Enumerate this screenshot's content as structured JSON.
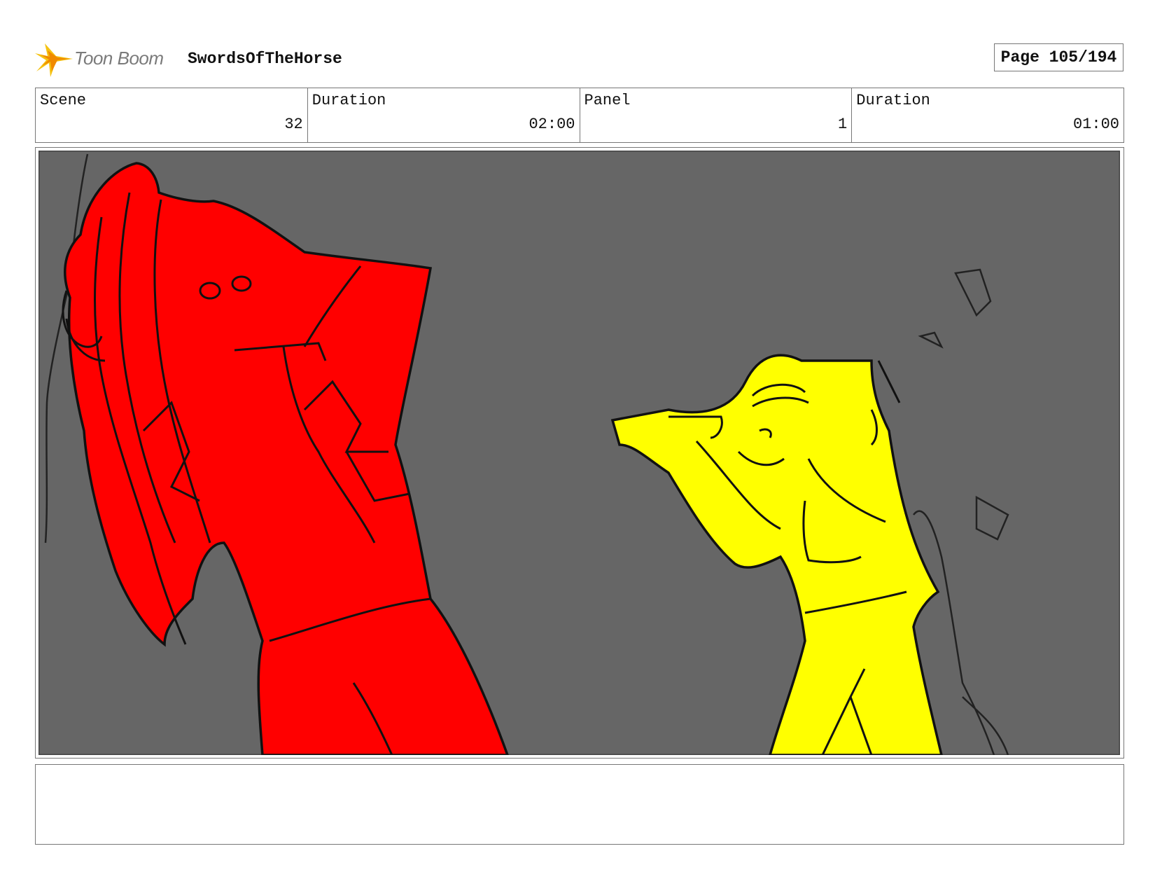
{
  "header": {
    "logo_text": "Toon Boom",
    "project_title": "SwordsOfTheHorse",
    "page_label": "Page 105/194"
  },
  "info": [
    {
      "label": "Scene",
      "value": "32"
    },
    {
      "label": "Duration",
      "value": "02:00"
    },
    {
      "label": "Panel",
      "value": "1"
    },
    {
      "label": "Duration",
      "value": "01:00"
    }
  ],
  "panel": {
    "background_color": "#666666",
    "foreground_character_color": "#ff0000",
    "background_character_color": "#ffff00"
  },
  "caption": ""
}
